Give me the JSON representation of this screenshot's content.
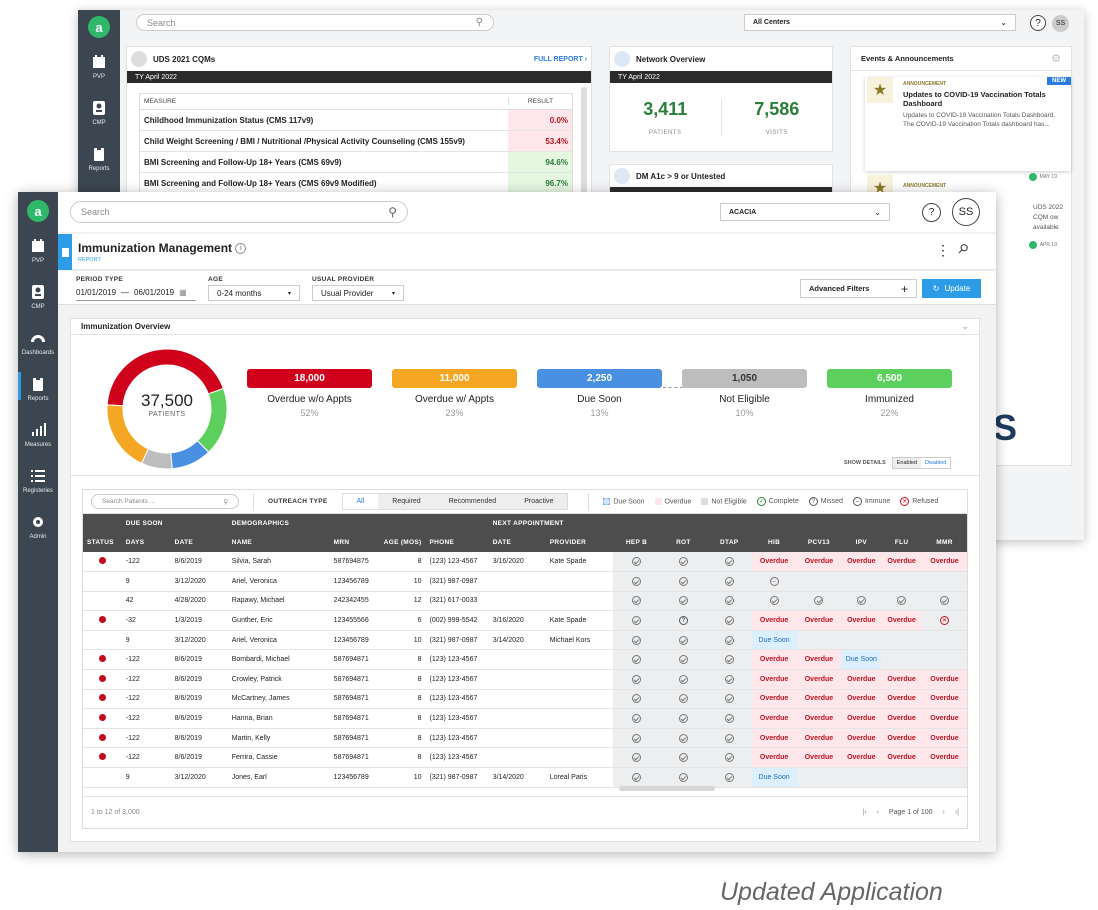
{
  "colors": {
    "overdue_no": "#d0021b",
    "overdue_w": "#f5a623",
    "due_soon": "#4a90e2",
    "not_eligible": "#bdbdbd",
    "immunized": "#5ccf5c",
    "accent": "#2c9ce6",
    "sidebar": "#3b4650"
  },
  "sidebar": {
    "items": [
      {
        "label": "PVP",
        "icon": "calendar-icon"
      },
      {
        "label": "CMP",
        "icon": "badge-icon"
      },
      {
        "label": "Dashboards",
        "icon": "gauge-icon"
      },
      {
        "label": "Reports",
        "icon": "clipboard-icon"
      },
      {
        "label": "Measures",
        "icon": "bars-icon"
      },
      {
        "label": "Registeries",
        "icon": "list-icon"
      },
      {
        "label": "Admin",
        "icon": "gear-icon"
      }
    ]
  },
  "back": {
    "search_placeholder": "Search",
    "center": "All Centers",
    "avatar": "SS",
    "help": "?",
    "uds": {
      "title": "UDS 2021 CQMs",
      "full_report": "FULL REPORT ›",
      "period": "TY April 2022",
      "col_measure": "MEASURE",
      "col_result": "RESULT",
      "rows": [
        {
          "m": "Childhood Immunization Status (CMS 117v9)",
          "r": "0.0%"
        },
        {
          "m": "Child Weight Screening / BMI / Nutritional /Physical Activity Counseling (CMS 155v9)",
          "r": "53.4%"
        },
        {
          "m": "BMI Screening and Follow-Up 18+ Years (CMS 69v9)",
          "r": "94.6%"
        },
        {
          "m": "BMI Screening and Follow-Up 18+ Years (CMS 69v9 Modified)",
          "r": "96.7%"
        }
      ]
    },
    "network": {
      "title": "Network Overview",
      "period": "TY April 2022",
      "patients": "3,411",
      "patients_lbl": "PATIENTS",
      "visits": "7,586",
      "visits_lbl": "VISITS"
    },
    "dm": {
      "title": "DM A1c > 9 or Untested"
    },
    "events": {
      "title": "Events & Announcements",
      "new": "NEW",
      "items": [
        {
          "tag": "ANNOUNCEMENT",
          "title": "Updates to COVID-19 Vaccination Totals Dashboard",
          "body": "Updates to COVID-19 Vaccination Totals Dashboard. The COVID-19 Vaccination Totals dashboard has...",
          "date": "MAY 19"
        },
        {
          "tag": "ANNOUNCEMENT",
          "title": "UDS 2022 Measures",
          "body": "UDS 2022 CQM ow available",
          "date": "APR 19"
        }
      ]
    }
  },
  "front": {
    "search_placeholder": "Search",
    "center": "ACACIA",
    "avatar": "SS",
    "help": "?",
    "page_title": "Immunization Management",
    "page_sub": "REPORT",
    "filters": {
      "period_lbl": "PERIOD TYPE",
      "period_from": "01/01/2019",
      "period_sep": "—",
      "period_to": "06/01/2019",
      "age_lbl": "AGE",
      "age_val": "0-24 months",
      "prov_lbl": "USUAL PROVIDER",
      "prov_val": "Usual Provider",
      "adv": "Advanced Filters",
      "update": "Update"
    },
    "overview": {
      "title": "Immunization Overview",
      "total": "37,500",
      "total_lbl": "PATIENTS",
      "show_details": "SHOW DETAILS",
      "enabled": "Enabled",
      "disabled": "Disabled"
    },
    "stats": [
      {
        "val": "18,000",
        "lbl": "Overdue w/o Appts",
        "pct": "52%",
        "pct_num": 52
      },
      {
        "val": "11,000",
        "lbl": "Overdue w/ Appts",
        "pct": "23%",
        "pct_num": 23
      },
      {
        "val": "2,250",
        "lbl": "Due Soon",
        "pct": "13%",
        "pct_num": 13
      },
      {
        "val": "1,050",
        "lbl": "Not Eligible",
        "pct": "10%",
        "pct_num": 10
      },
      {
        "val": "6,500",
        "lbl": "Immunized",
        "pct": "22%",
        "pct_num": 22
      }
    ],
    "toolbar": {
      "search_placeholder": "Search Patients ...",
      "outreach_lbl": "OUTREACH TYPE",
      "tabs": [
        "All",
        "Required",
        "Recommended",
        "Proactive"
      ]
    },
    "legend": [
      "Due Soon",
      "Overdue",
      "Not Eligible",
      "Complete",
      "Missed",
      "Immune",
      "Refused"
    ],
    "groups": {
      "due": "DUE SOON",
      "demo": "DEMOGRAPHICS",
      "next": "NEXT APPOINTMENT"
    },
    "cols": [
      "STATUS",
      "DAYS",
      "DATE",
      "NAME",
      "MRN",
      "AGE (MOS)",
      "PHONE",
      "DATE",
      "PROVIDER",
      "HEP B",
      "ROT",
      "DTAP",
      "HIB",
      "PCV13",
      "IPV",
      "FLU",
      "MMR"
    ],
    "rows": [
      {
        "st": 1,
        "days": "-122",
        "date": "8/6/2019",
        "name": "Silvia, Sarah",
        "mrn": "587694875",
        "age": "8",
        "phone": "(123) 123-4567",
        "ndate": "3/16/2020",
        "prov": "Kate Spade",
        "v": [
          "c",
          "c",
          "c",
          "Overdue",
          "Overdue",
          "Overdue",
          "Overdue",
          "Overdue"
        ]
      },
      {
        "st": 0,
        "days": "9",
        "date": "3/12/2020",
        "name": "Ariel, Veronica",
        "mrn": "123456789",
        "age": "10",
        "phone": "(321) 987-0987",
        "ndate": "",
        "prov": "",
        "v": [
          "c",
          "c",
          "c",
          "i",
          "",
          "",
          "",
          ""
        ]
      },
      {
        "st": 0,
        "days": "42",
        "date": "4/28/2020",
        "name": "Rapawy, Michael",
        "mrn": "242342455",
        "age": "12",
        "phone": "(321) 617-0033",
        "ndate": "",
        "prov": "",
        "v": [
          "c",
          "c",
          "c",
          "c",
          "c",
          "c",
          "c",
          "c"
        ]
      },
      {
        "st": 1,
        "days": "-32",
        "date": "1/3/2019",
        "name": "Gunther, Eric",
        "mrn": "123455566",
        "age": "6",
        "phone": "(002) 999-5542",
        "ndate": "3/16/2020",
        "prov": "Kate Spade",
        "v": [
          "c",
          "m",
          "c",
          "Overdue",
          "Overdue",
          "Overdue",
          "Overdue",
          "r"
        ]
      },
      {
        "st": 0,
        "days": "9",
        "date": "3/12/2020",
        "name": "Ariel, Veronica",
        "mrn": "123456789",
        "age": "10",
        "phone": "(321) 987-0987",
        "ndate": "3/14/2020",
        "prov": "Michael Kors",
        "v": [
          "c",
          "c",
          "c",
          "Due Soon",
          "",
          "",
          "",
          ""
        ]
      },
      {
        "st": 1,
        "days": "-122",
        "date": "8/6/2019",
        "name": "Bombardi, Michael",
        "mrn": "587694871",
        "age": "8",
        "phone": "(123) 123-4567",
        "ndate": "",
        "prov": "",
        "v": [
          "c",
          "c",
          "c",
          "Overdue",
          "Overdue",
          "Due Soon",
          "",
          ""
        ]
      },
      {
        "st": 1,
        "days": "-122",
        "date": "8/6/2019",
        "name": "Crowley, Patrick",
        "mrn": "587694871",
        "age": "8",
        "phone": "(123) 123-4567",
        "ndate": "",
        "prov": "",
        "v": [
          "c",
          "c",
          "c",
          "Overdue",
          "Overdue",
          "Overdue",
          "Overdue",
          "Overdue"
        ]
      },
      {
        "st": 1,
        "days": "-122",
        "date": "8/6/2019",
        "name": "McCartney, James",
        "mrn": "587694871",
        "age": "8",
        "phone": "(123) 123-4567",
        "ndate": "",
        "prov": "",
        "v": [
          "c",
          "c",
          "c",
          "Overdue",
          "Overdue",
          "Overdue",
          "Overdue",
          "Overdue"
        ]
      },
      {
        "st": 1,
        "days": "-122",
        "date": "8/6/2019",
        "name": "Hanna, Brian",
        "mrn": "587694871",
        "age": "8",
        "phone": "(123) 123-4567",
        "ndate": "",
        "prov": "",
        "v": [
          "c",
          "c",
          "c",
          "Overdue",
          "Overdue",
          "Overdue",
          "Overdue",
          "Overdue"
        ]
      },
      {
        "st": 1,
        "days": "-122",
        "date": "8/6/2019",
        "name": "Martin, Kelly",
        "mrn": "587694871",
        "age": "8",
        "phone": "(123) 123-4567",
        "ndate": "",
        "prov": "",
        "v": [
          "c",
          "c",
          "c",
          "Overdue",
          "Overdue",
          "Overdue",
          "Overdue",
          "Overdue"
        ]
      },
      {
        "st": 1,
        "days": "-122",
        "date": "8/6/2019",
        "name": "Ferrira, Cassie",
        "mrn": "587694871",
        "age": "8",
        "phone": "(123) 123-4567",
        "ndate": "",
        "prov": "",
        "v": [
          "c",
          "c",
          "c",
          "Overdue",
          "Overdue",
          "Overdue",
          "Overdue",
          "Overdue"
        ]
      },
      {
        "st": 0,
        "days": "9",
        "date": "3/12/2020",
        "name": "Jones, Earl",
        "mrn": "123456789",
        "age": "10",
        "phone": "(321) 987-0987",
        "ndate": "3/14/2020",
        "prov": "Loreal Paris",
        "v": [
          "c",
          "c",
          "c",
          "Due Soon",
          "",
          "",
          "",
          ""
        ]
      }
    ],
    "footer": {
      "count": "1 to 12 of 3,000",
      "page": "Page 1 of 100",
      "first": "|‹",
      "prev": "‹",
      "next": "›",
      "last": "›|"
    }
  },
  "caption": "Updated Application",
  "logo_fragment": "YS"
}
